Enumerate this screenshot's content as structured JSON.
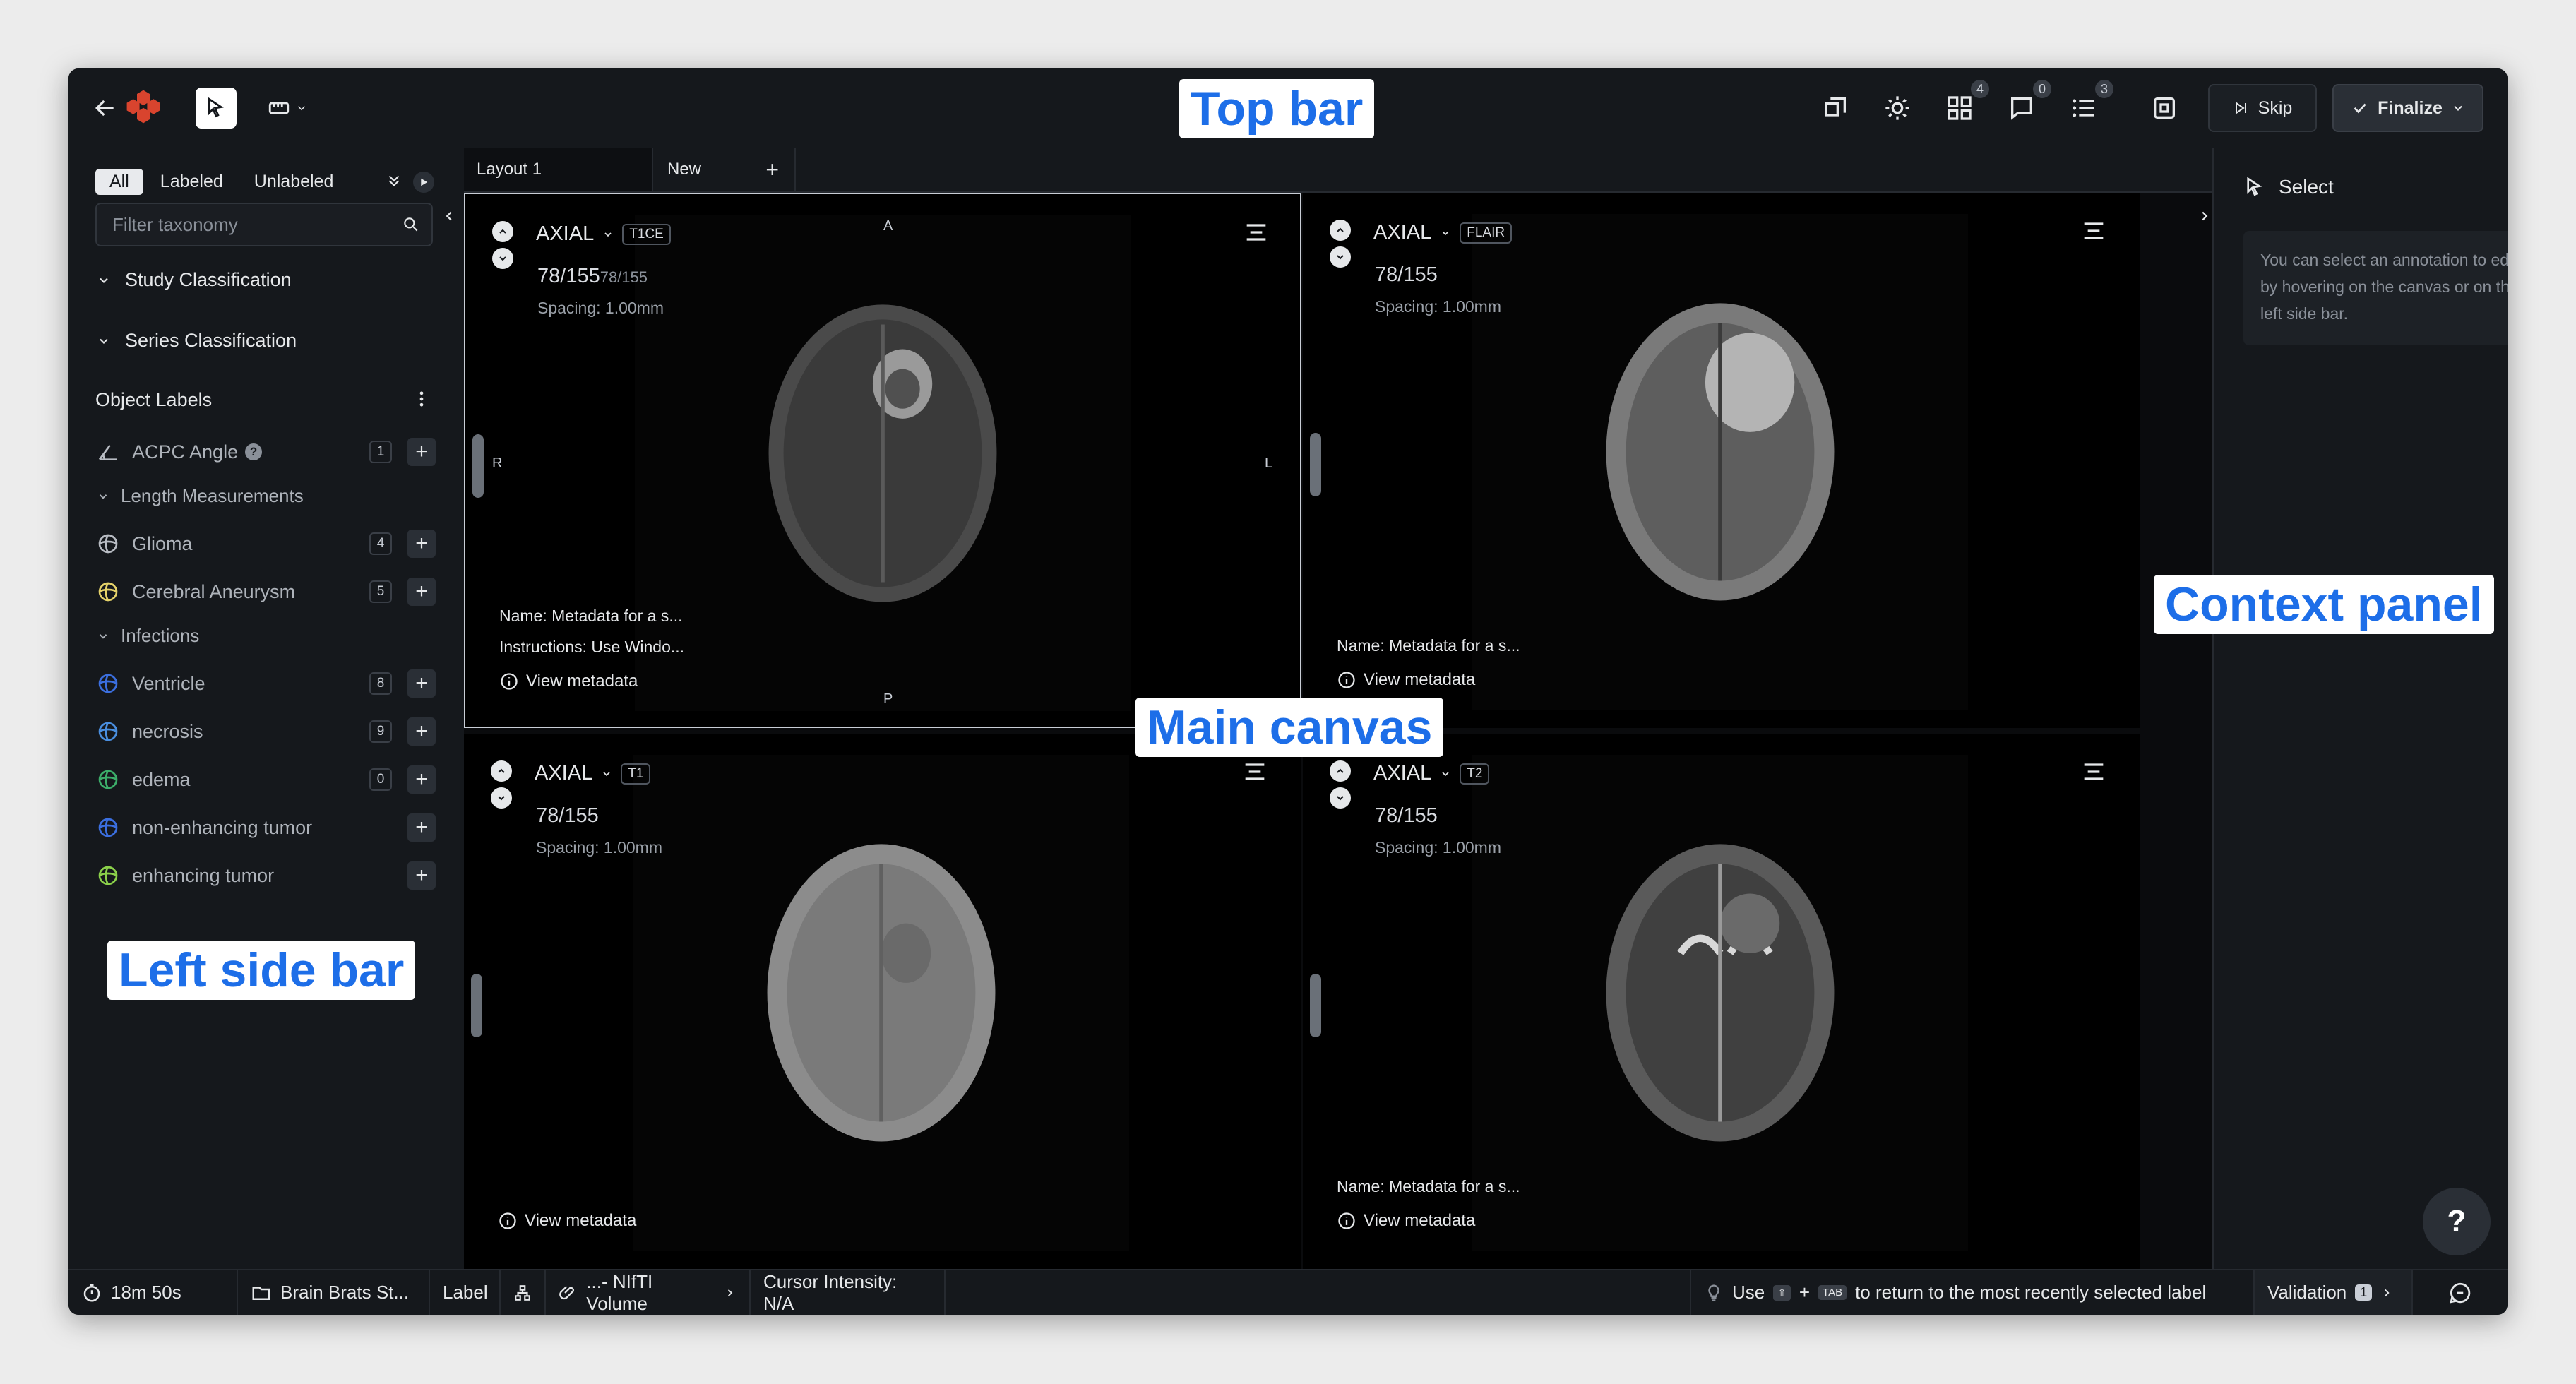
{
  "topbar": {
    "badges": {
      "layers": "4",
      "comments": "0",
      "list": "3"
    },
    "skip_label": "Skip",
    "finalize_label": "Finalize"
  },
  "leftbar": {
    "filters": [
      "All",
      "Labeled",
      "Unlabeled"
    ],
    "filter_placeholder": "Filter taxonomy",
    "study_classification": "Study Classification",
    "series_classification": "Series Classification",
    "object_labels": "Object Labels",
    "items": [
      {
        "label": "ACPC Angle",
        "count": "1",
        "color": "#b8bcc3"
      },
      {
        "label": "Length Measurements",
        "group": true
      },
      {
        "label": "Glioma",
        "count": "4",
        "color": "#b8bcc3"
      },
      {
        "label": "Cerebral Aneurysm",
        "count": "5",
        "color": "#e6d36a"
      },
      {
        "label": "Infections",
        "group": true
      },
      {
        "label": "Ventricle",
        "count": "8",
        "color": "#3b6fe0"
      },
      {
        "label": "necrosis",
        "count": "9",
        "color": "#4a8fe0"
      },
      {
        "label": "edema",
        "count": "0",
        "color": "#3cae6a"
      },
      {
        "label": "non-enhancing tumor",
        "count": "",
        "color": "#3b6fe0"
      },
      {
        "label": "enhancing tumor",
        "count": "",
        "color": "#8bd14a"
      }
    ]
  },
  "tabs": [
    "Layout 1",
    "New"
  ],
  "viewports": [
    {
      "plane": "AXIAL",
      "sequence": "T1CE",
      "slice": "78/155",
      "slice_sub": "78/155",
      "spacing": "Spacing: 1.00mm",
      "name": "Name: Metadata for a s...",
      "instructions": "Instructions: Use Windo...",
      "view_meta": "View metadata",
      "orient": {
        "top": "A",
        "left": "R",
        "right": "L",
        "bottom": "P"
      }
    },
    {
      "plane": "AXIAL",
      "sequence": "FLAIR",
      "slice": "78/155",
      "spacing": "Spacing: 1.00mm",
      "name": "Name: Metadata for a s...",
      "view_meta": "View metadata"
    },
    {
      "plane": "AXIAL",
      "sequence": "T1",
      "slice": "78/155",
      "spacing": "Spacing: 1.00mm",
      "view_meta": "View metadata"
    },
    {
      "plane": "AXIAL",
      "sequence": "T2",
      "slice": "78/155",
      "spacing": "Spacing: 1.00mm",
      "name": "Name: Metadata for a s...",
      "view_meta": "View metadata"
    }
  ],
  "rightbar": {
    "title": "Select",
    "hint": "You can select an annotation to edit by hovering on the canvas or on the left side bar."
  },
  "bottombar": {
    "timer": "18m 50s",
    "dataset": "Brain Brats St...",
    "label": "Label",
    "volume": "...- NIfTI Volume",
    "cursor": "Cursor Intensity: N/A",
    "tip_use": "Use",
    "tip_tab": "TAB",
    "tip_text": "to return to the most recently selected label",
    "validation": "Validation",
    "validation_count": "1"
  },
  "annotations": {
    "top_bar": "Top bar",
    "context_panel": "Context panel",
    "main_canvas": "Main canvas",
    "left_side_bar": "Left side bar"
  }
}
